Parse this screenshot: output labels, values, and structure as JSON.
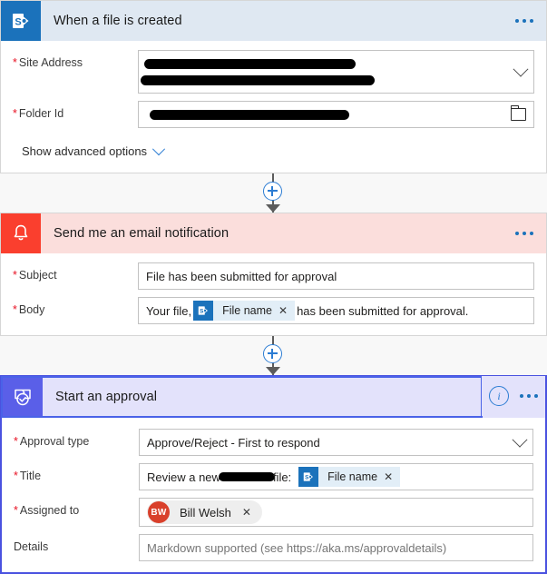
{
  "flow": {
    "cards": [
      {
        "id": "trigger-sharepoint",
        "title": "When a file is created",
        "icon": "sharepoint-icon",
        "header_color": "#dfe8f2",
        "icon_color": "#1b72bb",
        "more_label": "...",
        "fields": [
          {
            "label": "Site Address",
            "required": true,
            "value": "[redacted]",
            "control": "dropdown"
          },
          {
            "label": "Folder Id",
            "required": true,
            "value": "[redacted]",
            "control": "folder-picker"
          }
        ],
        "advanced_label": "Show advanced options"
      },
      {
        "id": "action-email-notification",
        "title": "Send me an email notification",
        "icon": "bell-icon",
        "header_color": "#fbdedc",
        "icon_color": "#fa3f2e",
        "more_label": "...",
        "fields": [
          {
            "label": "Subject",
            "required": true,
            "value": "File has been submitted for approval"
          },
          {
            "label": "Body",
            "required": true,
            "prefix": "Your file,",
            "token": {
              "label": "File name",
              "icon": "sharepoint-icon",
              "remove": "✕"
            },
            "suffix": "has been submitted for approval."
          }
        ]
      },
      {
        "id": "action-start-approval",
        "title": "Start an approval",
        "icon": "approval-icon",
        "header_color": "#e3e2fb",
        "icon_color": "#5a5fe8",
        "selected": true,
        "info_label": "i",
        "more_label": "...",
        "fields": [
          {
            "label": "Approval type",
            "required": true,
            "value": "Approve/Reject - First to respond",
            "control": "dropdown"
          },
          {
            "label": "Title",
            "required": true,
            "prefix": "Review a new",
            "prefix2": "file:",
            "token": {
              "label": "File name",
              "icon": "sharepoint-icon",
              "remove": "✕"
            }
          },
          {
            "label": "Assigned to",
            "required": true,
            "person": {
              "initials": "BW",
              "name": "Bill Welsh",
              "remove": "✕",
              "avatar_color": "#d9402b"
            }
          },
          {
            "label": "Details",
            "required": false,
            "placeholder": "Markdown supported (see https://aka.ms/approvaldetails)"
          }
        ]
      }
    ],
    "connectors": [
      {
        "add_label": "+"
      },
      {
        "add_label": "+"
      }
    ]
  }
}
